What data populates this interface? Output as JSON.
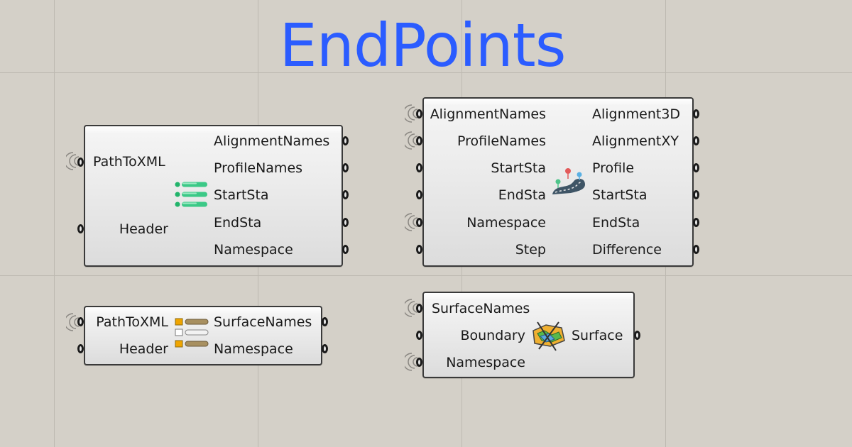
{
  "title": "EndPoints",
  "components": {
    "alignment_reader": {
      "inputs": [
        "PathToXML",
        "Header"
      ],
      "outputs": [
        "AlignmentNames",
        "ProfileNames",
        "StartSta",
        "EndSta",
        "Namespace"
      ],
      "icon": "list-icon"
    },
    "alignment_builder": {
      "inputs": [
        "AlignmentNames",
        "ProfileNames",
        "StartSta",
        "EndSta",
        "Namespace",
        "Step"
      ],
      "outputs": [
        "Alignment3D",
        "AlignmentXY",
        "Profile",
        "StartSta",
        "EndSta",
        "Difference"
      ],
      "icon": "road-icon"
    },
    "surface_reader": {
      "inputs": [
        "PathToXML",
        "Header"
      ],
      "outputs": [
        "SurfaceNames",
        "Namespace"
      ],
      "icon": "surface-list-icon"
    },
    "surface_builder": {
      "inputs": [
        "SurfaceNames",
        "Boundary",
        "Namespace"
      ],
      "outputs": [
        "Surface"
      ],
      "icon": "terrain-map-icon"
    }
  },
  "colors": {
    "title": "#2b5cff",
    "canvas": "#d4d0c8",
    "component_border": "#3a3a3a"
  }
}
